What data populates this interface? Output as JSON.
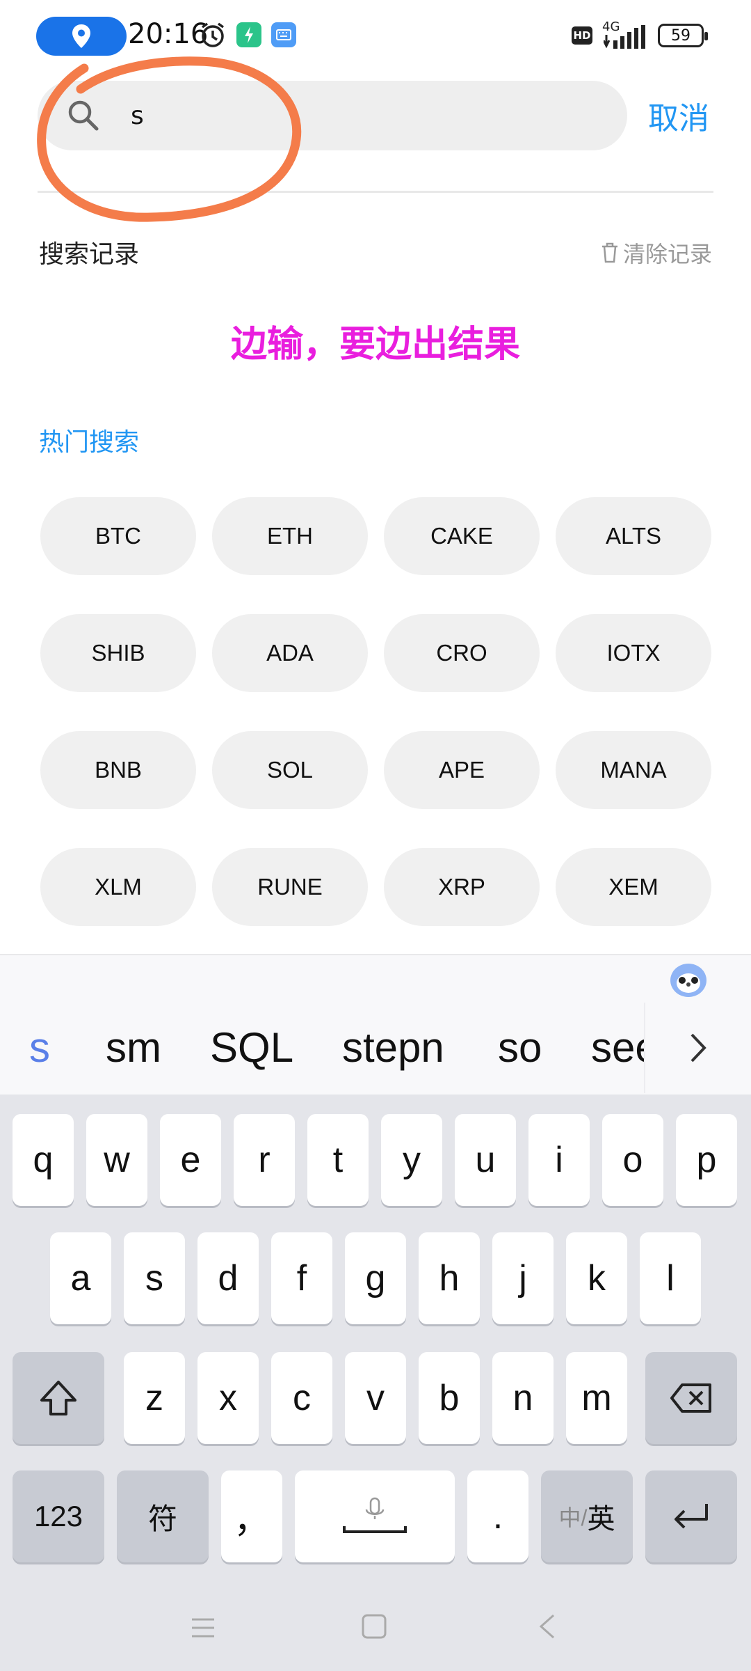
{
  "status_bar": {
    "time": "20:16",
    "network": "4G",
    "hd_badge": "HD",
    "battery": "59",
    "icons": [
      "location-icon",
      "alarm-icon",
      "app-icon",
      "keyboard-icon",
      "signal-icon",
      "battery-icon"
    ]
  },
  "search": {
    "value": "s",
    "cancel_label": "取消"
  },
  "history": {
    "title": "搜索记录",
    "clear_label": "清除记录"
  },
  "annotation": {
    "text": "边输，要边出结果",
    "color": "#e91ede",
    "circle_color": "#f47c4a"
  },
  "hot": {
    "title": "热门搜索",
    "items": [
      "BTC",
      "ETH",
      "CAKE",
      "ALTS",
      "SHIB",
      "ADA",
      "CRO",
      "IOTX",
      "BNB",
      "SOL",
      "APE",
      "MANA",
      "XLM",
      "RUNE",
      "XRP",
      "XEM"
    ]
  },
  "keyboard": {
    "suggestions": [
      "s",
      "sm",
      "SQL",
      "stepn",
      "so",
      "see"
    ],
    "row1": [
      "q",
      "w",
      "e",
      "r",
      "t",
      "y",
      "u",
      "i",
      "o",
      "p"
    ],
    "row2": [
      "a",
      "s",
      "d",
      "f",
      "g",
      "h",
      "j",
      "k",
      "l"
    ],
    "row3": [
      "z",
      "x",
      "c",
      "v",
      "b",
      "n",
      "m"
    ],
    "numbers_label": "123",
    "symbols_label": "符",
    "comma_label": "，",
    "period_label": ".",
    "lang_label_a": "中/",
    "lang_label_b": "英"
  },
  "colors": {
    "accent": "#2196f3",
    "chip_bg": "#f0f0f0",
    "keyboard_bg": "#e4e5ea"
  }
}
